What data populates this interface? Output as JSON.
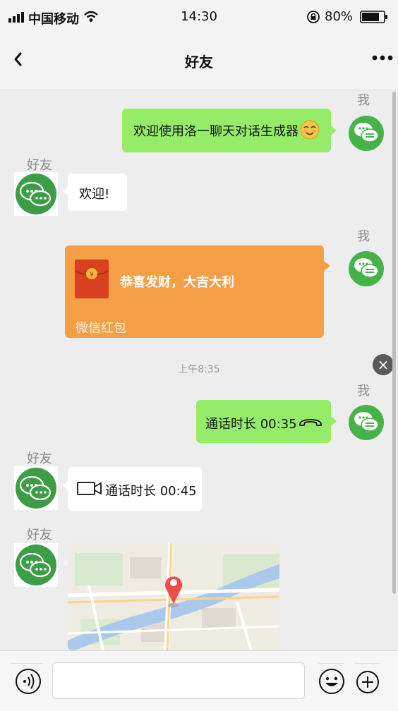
{
  "status": {
    "carrier": "中国移动",
    "time": "14:30",
    "battery_percent": "80%",
    "battery_level": 0.8
  },
  "nav": {
    "title": "好友",
    "back_glyph": "‹"
  },
  "messages": [
    {
      "sender": "我",
      "type": "text",
      "text": "欢迎使用洛一聊天对话生成器",
      "emoji": "smiling-face-icon"
    },
    {
      "sender": "好友",
      "type": "text",
      "text": "欢迎!"
    },
    {
      "sender": "我",
      "type": "red_packet",
      "text": "恭喜发财，大吉大利",
      "footer": "微信红包"
    },
    {
      "type": "timestamp",
      "text": "上午8:35"
    },
    {
      "sender": "我",
      "type": "call",
      "text": "通话时长 00:35",
      "icon": "hangup-phone-icon"
    },
    {
      "sender": "好友",
      "type": "video_call",
      "text": "通话时长 00:45",
      "icon": "video-camera-icon"
    },
    {
      "sender": "好友",
      "type": "location",
      "icon": "map-pin-icon"
    }
  ],
  "close_glyph": "×",
  "input_bar": {
    "voice_icon": "voice-icon",
    "emoji_icon": "emoji-icon",
    "plus_icon": "plus-icon",
    "input_value": ""
  },
  "colors": {
    "my_bubble": "#95ec69",
    "friend_bubble": "#ffffff",
    "red_packet": "#f59e48",
    "background": "#ededed"
  }
}
